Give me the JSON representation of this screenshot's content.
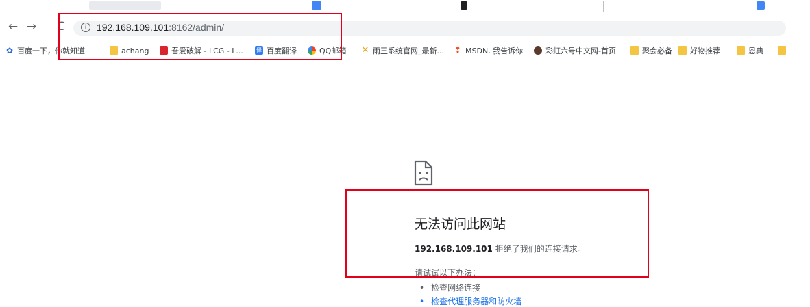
{
  "toolbar": {
    "back_icon": "←",
    "forward_icon": "→",
    "reload_icon": "C",
    "info_icon": "i",
    "url_host": "192.168.109.101",
    "url_rest": ":8162/admin/"
  },
  "bookmarks": [
    {
      "label": "百度一下，你就知道",
      "icon": "baidu-icon"
    },
    {
      "label": "achang",
      "icon": "folder-icon"
    },
    {
      "label": "吾爱破解 - LCG - L...",
      "icon": "52pojie-icon"
    },
    {
      "label": "百度翻译",
      "icon": "baidu-translate-icon"
    },
    {
      "label": "QQ邮箱",
      "icon": "qq-mail-icon"
    },
    {
      "label": "雨王系统官网_最新...",
      "icon": "system-site-icon"
    },
    {
      "label": "MSDN, 我告诉你",
      "icon": "msdn-icon"
    },
    {
      "label": "彩虹六号中文网-首页",
      "icon": "rainbow-six-icon"
    },
    {
      "label": "聚会必备",
      "icon": "folder-icon"
    },
    {
      "label": "好物推荐",
      "icon": "folder-icon"
    },
    {
      "label": "恩典",
      "icon": "folder-icon"
    }
  ],
  "error": {
    "icon": "sad-page-icon",
    "title": "无法访问此网站",
    "detail_host": "192.168.109.101",
    "detail_text": " 拒绝了我们的连接请求。",
    "try_text": "请试试以下办法：",
    "suggestions": [
      "检查网络连接",
      "检查代理服务器和防火墙"
    ]
  },
  "colors": {
    "highlight_box": "#e3001b",
    "omnibox_bg": "#f1f3f4",
    "folder": "#f4c542"
  }
}
